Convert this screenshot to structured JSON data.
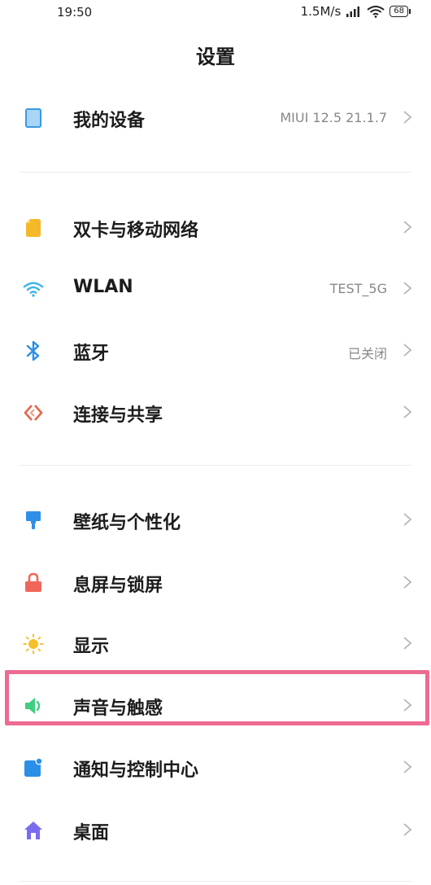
{
  "status_bar": {
    "time": "19:50",
    "speed": "1.5M/s",
    "battery": "68"
  },
  "header": {
    "title": "设置"
  },
  "sections": [
    {
      "items": [
        {
          "label": "我的设备",
          "value": "MIUI 12.5 21.1.7",
          "icon": "tablet-icon",
          "color": "#4aa8e8"
        }
      ]
    },
    {
      "items": [
        {
          "label": "双卡与移动网络",
          "value": "",
          "icon": "sim-card-icon",
          "color": "#f5b828"
        },
        {
          "label": "WLAN",
          "value": "TEST_5G",
          "icon": "wifi-icon",
          "color": "#3db4ea"
        },
        {
          "label": "蓝牙",
          "value": "已关闭",
          "icon": "bluetooth-icon",
          "color": "#2a8fe6"
        },
        {
          "label": "连接与共享",
          "value": "",
          "icon": "share-icon",
          "color": "#e4664a"
        }
      ]
    },
    {
      "items": [
        {
          "label": "壁纸与个性化",
          "value": "",
          "icon": "paintbrush-icon",
          "color": "#2f8fe8"
        },
        {
          "label": "息屏与锁屏",
          "value": "",
          "icon": "lock-icon",
          "color": "#f0675a"
        },
        {
          "label": "显示",
          "value": "",
          "icon": "sun-icon",
          "color": "#f6c02c"
        },
        {
          "label": "声音与触感",
          "value": "",
          "icon": "speaker-icon",
          "color": "#3fcf7e"
        },
        {
          "label": "通知与控制中心",
          "value": "",
          "icon": "notification-icon",
          "color": "#2a8fe6"
        },
        {
          "label": "桌面",
          "value": "",
          "icon": "home-icon",
          "color": "#7a6cf0"
        }
      ]
    }
  ],
  "highlight_color": "#ec6b90"
}
